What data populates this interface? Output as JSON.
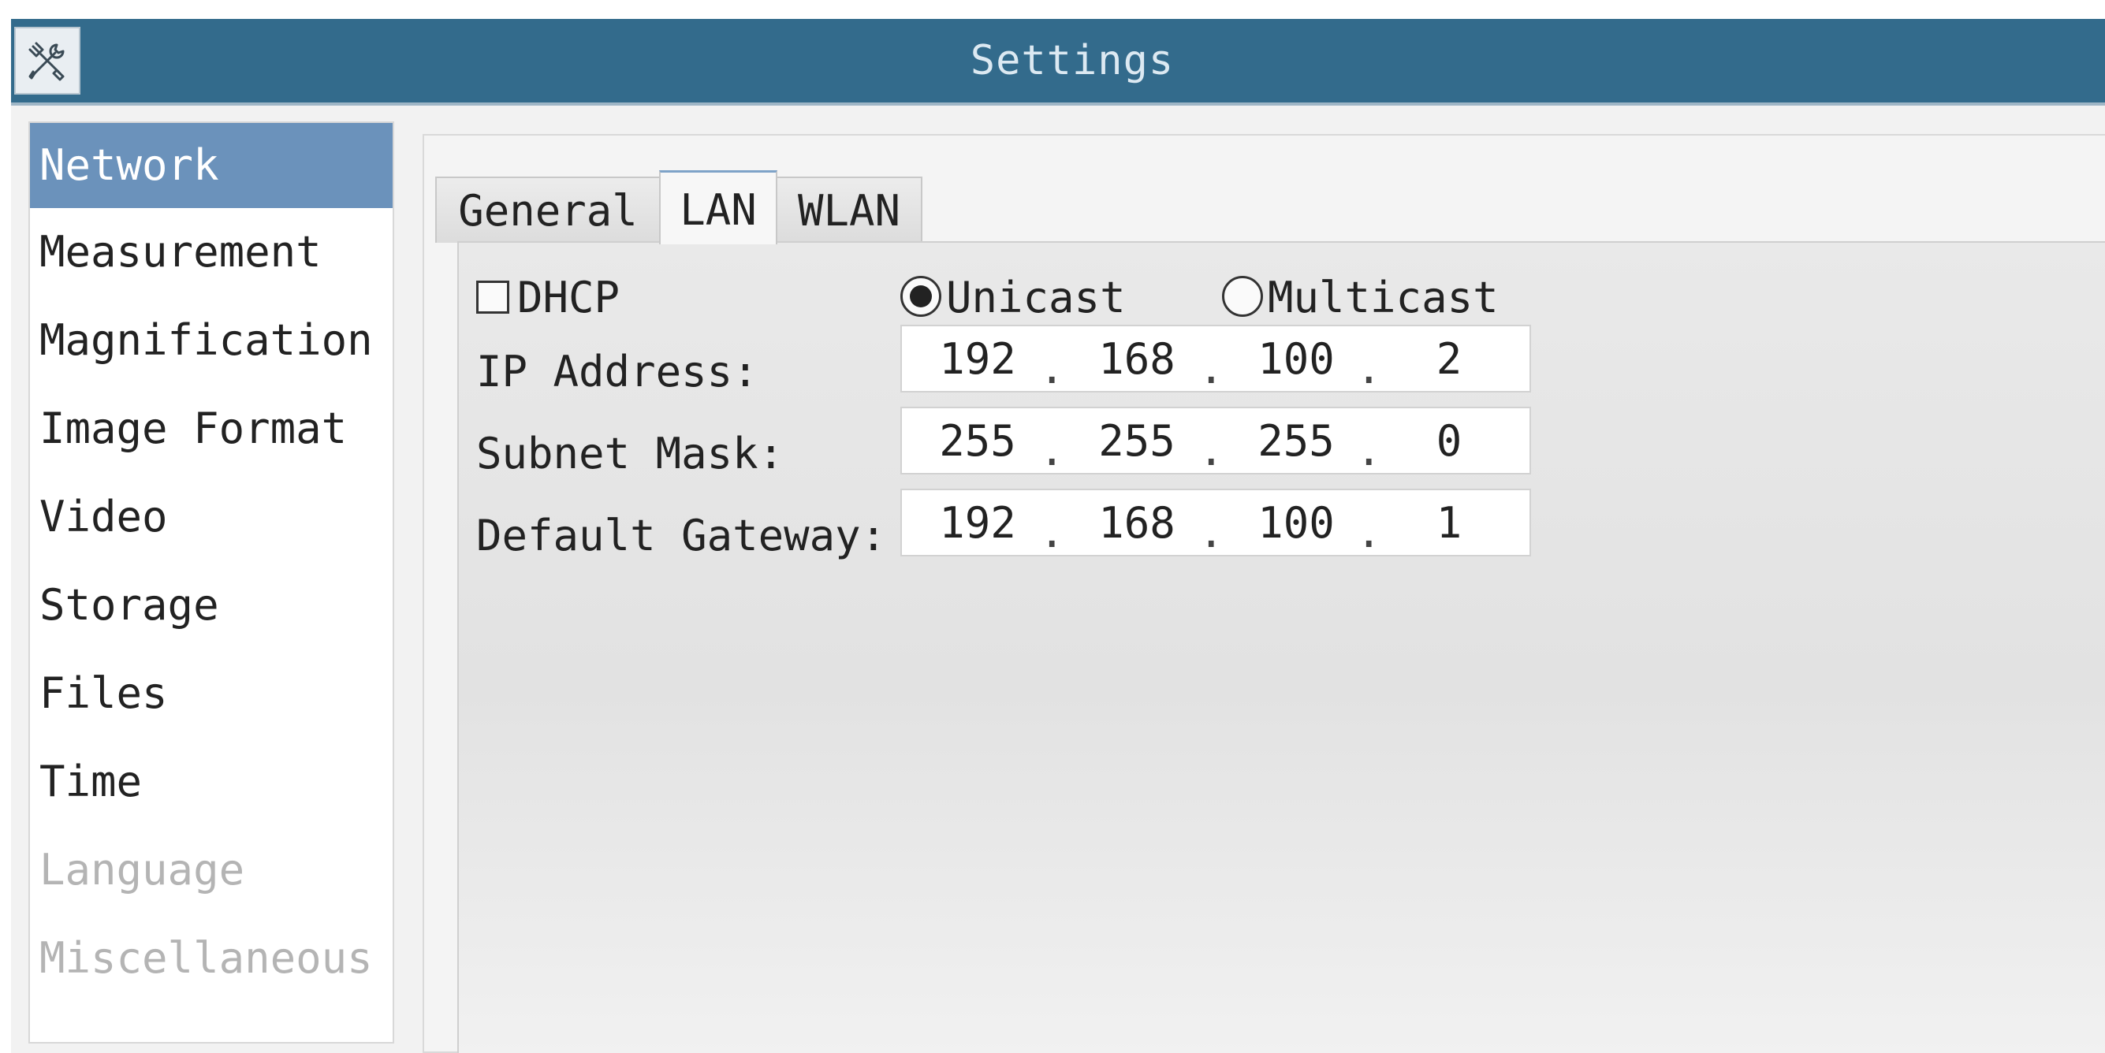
{
  "window": {
    "title": "Settings",
    "app_icon": "tools-icon"
  },
  "sidebar": {
    "items": [
      {
        "label": "Network",
        "selected": true
      },
      {
        "label": "Measurement"
      },
      {
        "label": "Magnification"
      },
      {
        "label": "Image Format"
      },
      {
        "label": "Video"
      },
      {
        "label": "Storage"
      },
      {
        "label": "Files"
      },
      {
        "label": "Time"
      },
      {
        "label": "Language",
        "disabled": true
      },
      {
        "label": "Miscellaneous",
        "disabled": true
      }
    ]
  },
  "tabs": [
    {
      "label": "General"
    },
    {
      "label": "LAN",
      "active": true
    },
    {
      "label": "WLAN"
    }
  ],
  "lan": {
    "dhcp": {
      "label": "DHCP",
      "checked": false
    },
    "unicast": {
      "label": "Unicast",
      "selected": true
    },
    "multicast": {
      "label": "Multicast",
      "selected": false
    },
    "fields": [
      {
        "label": "IP Address:",
        "octets": [
          "192",
          "168",
          "100",
          "2"
        ]
      },
      {
        "label": "Subnet Mask:",
        "octets": [
          "255",
          "255",
          "255",
          "0"
        ]
      },
      {
        "label": "Default Gateway:",
        "octets": [
          "192",
          "168",
          "100",
          "1"
        ]
      }
    ],
    "separator": "."
  },
  "colors": {
    "titlebar": "#336b8c",
    "selected_item": "#6b92bb",
    "disabled_text": "#b4b4b4"
  }
}
